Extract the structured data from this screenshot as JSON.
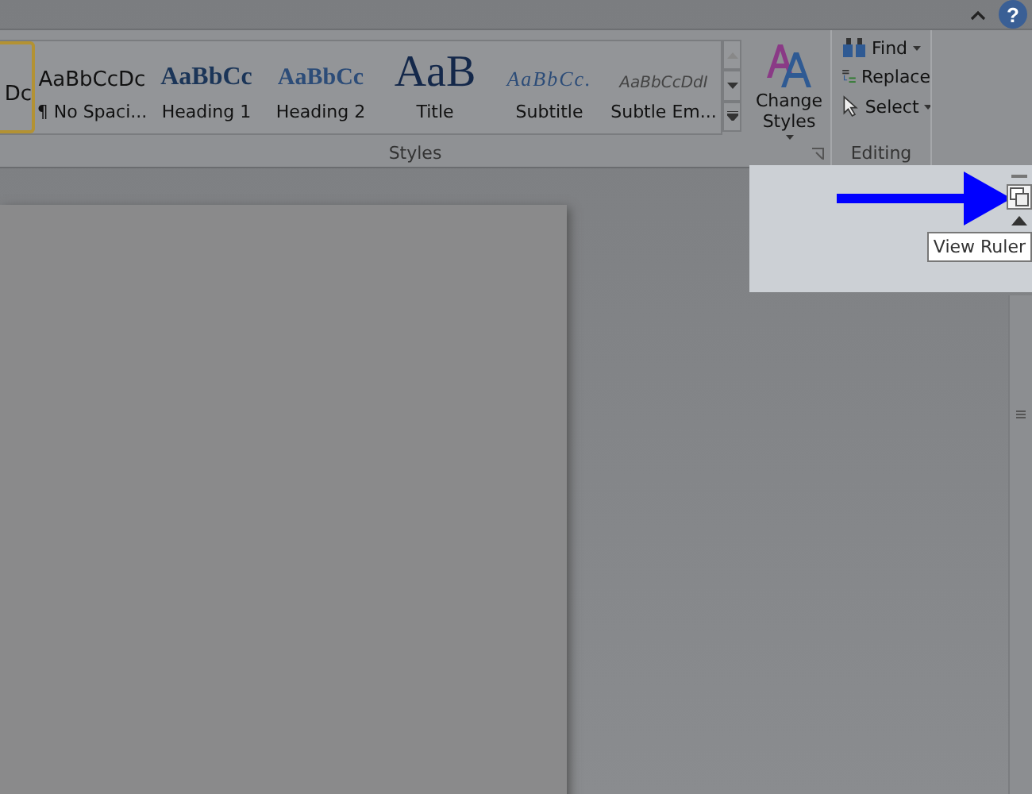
{
  "ribbon": {
    "styles": {
      "items": [
        {
          "sample": "Dc",
          "kind": "normal",
          "selected": true
        },
        {
          "sample": "AaBbCcDc",
          "label": "¶ No Spaci...",
          "kind": "normal",
          "selected": false
        },
        {
          "sample": "AaBbCc",
          "label": "Heading 1",
          "kind": "heading1",
          "selected": false
        },
        {
          "sample": "AaBbCc",
          "label": "Heading 2",
          "kind": "heading2",
          "selected": false
        },
        {
          "sample": "AaB",
          "label": "Title",
          "kind": "title",
          "selected": false
        },
        {
          "sample": "AaBbCc.",
          "label": "Subtitle",
          "kind": "subtitle",
          "selected": false
        },
        {
          "sample": "AaBbCcDdI",
          "label": "Subtle Em...",
          "kind": "subtle",
          "selected": false
        }
      ],
      "change_styles": "Change Styles",
      "group_label": "Styles"
    },
    "editing": {
      "items": [
        {
          "label": "Find",
          "dropdown": true,
          "kind": "find"
        },
        {
          "label": "Replace",
          "dropdown": false,
          "kind": "replace"
        },
        {
          "label": "Select",
          "dropdown": true,
          "kind": "select"
        }
      ],
      "group_label": "Editing"
    }
  },
  "help": "?",
  "tooltip": "View Ruler"
}
